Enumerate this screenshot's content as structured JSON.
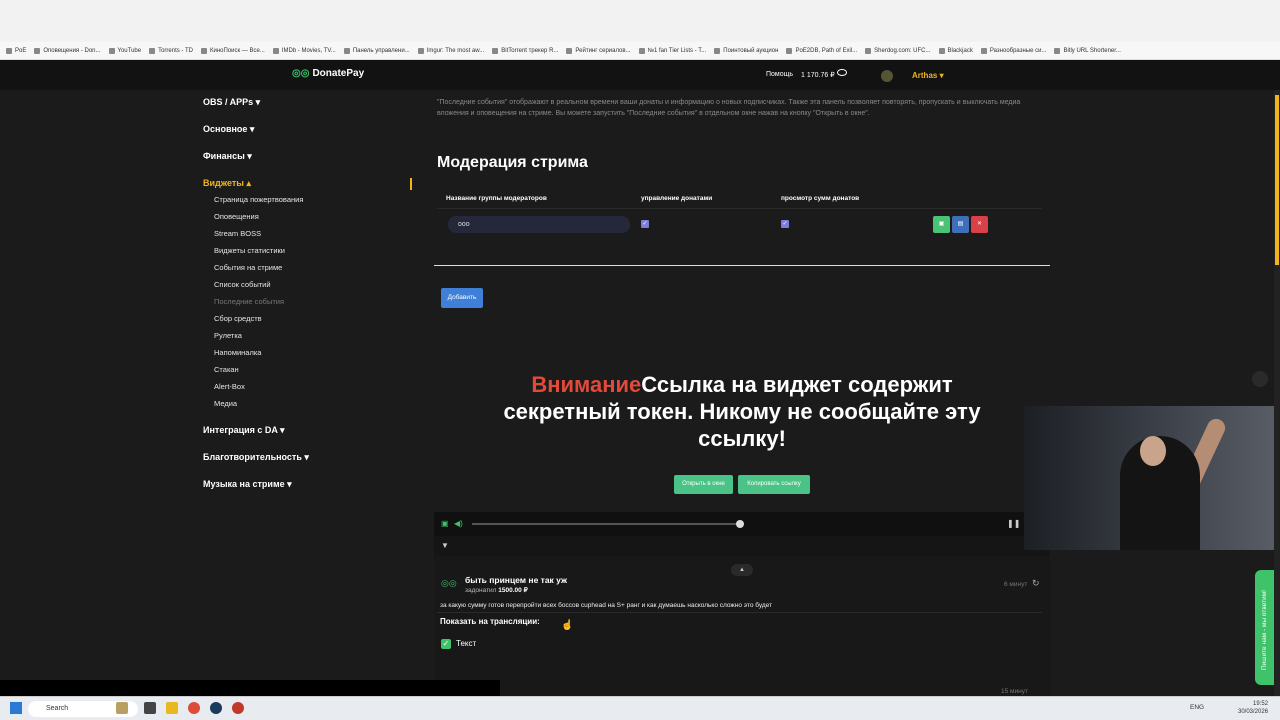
{
  "bookmarks": [
    "PoE",
    "Оповещения - Don...",
    "YouTube",
    "Torrents - TD",
    "КиноПоиск — Все...",
    "IMDb - Movies, TV...",
    "Панель управлени...",
    "Imgur: The most aw...",
    "BitTorrent трекер R...",
    "Рейтинг сериалов...",
    "№1 fan Tier Lists - T...",
    "Поинтовый аукцион",
    "PoE2DB, Path of Exil...",
    "Sherdog.com: UFC...",
    "Blackjack",
    "Разнообразные си...",
    "Bitly URL Shortener..."
  ],
  "header": {
    "brand": "DonatePay",
    "help": "Помощь",
    "balance": "1 170.76 ₽",
    "user": "Arthas ▾"
  },
  "sidebar": {
    "sections": [
      {
        "label": "OBS / APPs ▾"
      },
      {
        "label": "Основное ▾"
      },
      {
        "label": "Финансы ▾"
      },
      {
        "label": "Виджеты ▴"
      }
    ],
    "widgets": [
      "Страница пожертвования",
      "Оповещения",
      "Stream BOSS",
      "Виджеты статистики",
      "События на стриме",
      "Список событий",
      "Последние события",
      "Сбор средств",
      "Рулетка",
      "Напоминалка",
      "Стакан",
      "Alert-Box",
      "Медиа"
    ],
    "bottom_sections": [
      "Интеграция с DA ▾",
      "Благотворительность ▾",
      "Музыка на стриме ▾"
    ]
  },
  "main": {
    "description": "\"Последние события\" отображают в реальном времени ваши донаты и информацию о новых подписчиках. Также эта панель позволяет повторять, пропускать и выключать медиа вложения и оповещения на стриме. Вы можете запустить \"Последние события\" в отдельном окне нажав на кнопку \"Открыть в окне\".",
    "moderation_title": "Модерация стрима",
    "table_headers": [
      "Название группы модераторов",
      "управление донатами",
      "просмотр сумм донатов"
    ],
    "group_value": "ооо",
    "add_label": "Добавить",
    "warning_red": "Внимание",
    "warning_text": "Ссылка на виджет содержит секретный токен. Никому не сообщайте эту ссылку!",
    "open_window": "Открыть в окне",
    "copy_link": "Копировать ссылку"
  },
  "event": {
    "name": "быть принцем не так уж",
    "donated_label": "задонатил",
    "amount": "1500.00 ₽",
    "time": "6 минут",
    "message": "за какую сумму готов перепройти всех боссов cuphead на S+ ранг и как думаешь насколько сложно это будет",
    "show_label": "Показать на трансляции:",
    "text_option": "Текст",
    "next_time": "15 минут"
  },
  "chat_tab": "Пишите нам - мы ответим!",
  "taskbar": {
    "search": "Search",
    "lang": "ENG",
    "time": "19:52",
    "date": "30/03/2026"
  },
  "colors": {
    "accent": "#f0b51c",
    "green": "#3ec36b",
    "blue": "#3f7fd8",
    "red": "#e14a3a"
  }
}
